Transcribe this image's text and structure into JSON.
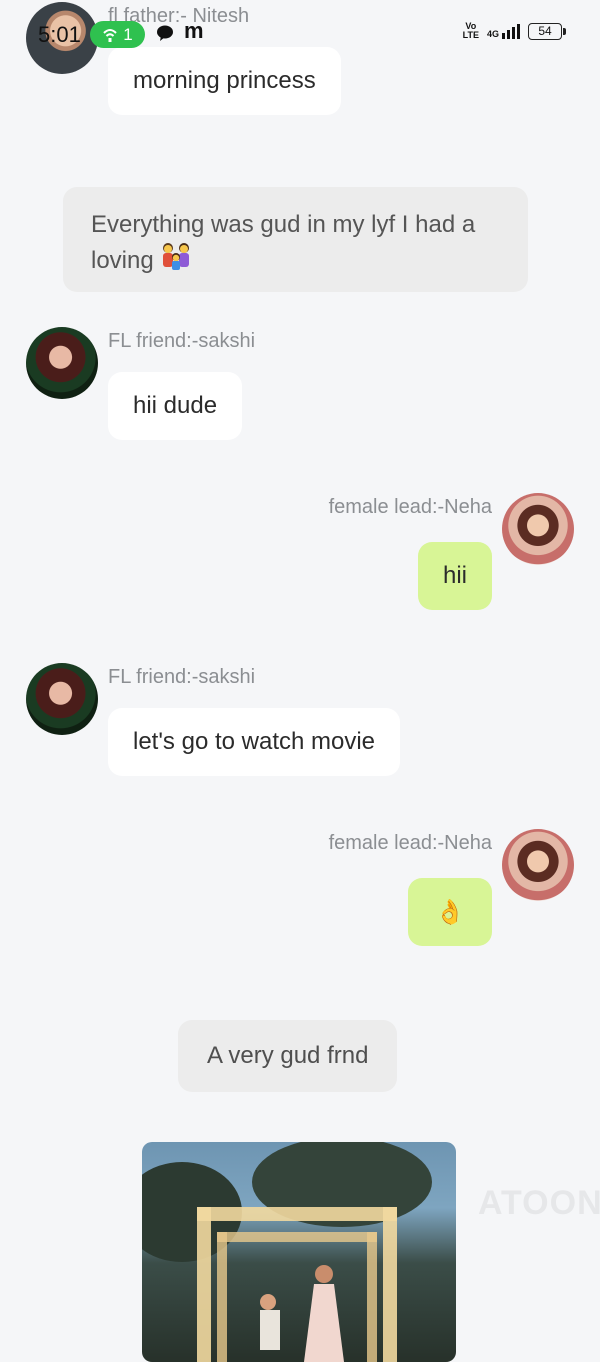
{
  "status_bar": {
    "time": "5:01",
    "hotspot_count": "1",
    "notif_app_letter": "m",
    "volte_top": "Vo",
    "volte_bottom": "LTE",
    "network": "4G",
    "battery": "54"
  },
  "messages": [
    {
      "type": "incoming",
      "sender": "fl father:- Nitesh",
      "text": "morning princess",
      "avatar_icon": "nitesh-avatar"
    },
    {
      "type": "narration",
      "text": "Everything was gud in my lyf I had a loving",
      "emoji": "family-icon"
    },
    {
      "type": "incoming",
      "sender": "FL friend:-sakshi",
      "text": "hii dude",
      "avatar_icon": "sakshi-avatar"
    },
    {
      "type": "outgoing",
      "sender": "female lead:-Neha",
      "text": "hii",
      "avatar_icon": "neha-avatar"
    },
    {
      "type": "incoming",
      "sender": "FL friend:-sakshi",
      "text": "let's go to watch movie",
      "avatar_icon": "sakshi-avatar"
    },
    {
      "type": "outgoing",
      "sender": "female lead:-Neha",
      "text": "👌",
      "avatar_icon": "neha-avatar"
    },
    {
      "type": "narration",
      "text": "A very gud frnd"
    },
    {
      "type": "image",
      "alt_icon": "proposal-photo"
    }
  ],
  "watermark": "ATOON",
  "colors": {
    "background": "#f5f6f8",
    "incoming_bubble": "#ffffff",
    "outgoing_bubble": "#d8f596",
    "narration_bubble": "#ececec",
    "sender_text": "#8b8e92",
    "hotspot_pill": "#2fc14f"
  }
}
